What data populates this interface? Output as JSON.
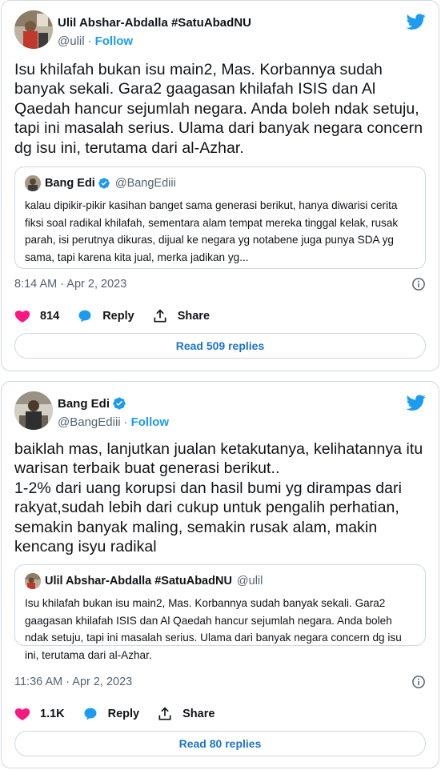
{
  "colors": {
    "accent": "#1d9bf0",
    "like": "#f91880",
    "text": "#0f1419",
    "muted": "#536471",
    "border": "#cfd9de"
  },
  "tweets": [
    {
      "author": {
        "name": "Ulil Abshar-Abdalla #SatuAbadNU",
        "handle": "@ulil",
        "verified": false
      },
      "follow_label": "Follow",
      "separator": "·",
      "text": "Isu khilafah bukan isu main2, Mas. Korbannya sudah banyak sekali. Gara2 gaagasan khilafah ISIS dan Al Qaedah hancur sejumlah negara. Anda boleh ndak setuju, tapi ini masalah serius. Ulama dari banyak negara concern dg isu ini, terutama dari al-Azhar.",
      "quote": {
        "name": "Bang Edi",
        "handle": "@BangEdiii",
        "verified": true,
        "text": "kalau dipikir-pikir kasihan banget sama generasi berikut, hanya diwarisi cerita fiksi soal radikal khilafah, sementara alam tempat mereka tinggal kelak, rusak parah, isi perutnya dikuras, dijual ke negara yg notabene juga punya SDA yg sama, tapi karena kita jual, merka jadikan yg..."
      },
      "timestamp": "8:14 AM · Apr 2, 2023",
      "likes": "814",
      "reply_label": "Reply",
      "share_label": "Share",
      "read_replies_label": "Read 509 replies"
    },
    {
      "author": {
        "name": "Bang Edi",
        "handle": "@BangEdiii",
        "verified": true
      },
      "follow_label": "Follow",
      "separator": "·",
      "text": "baiklah mas, lanjutkan jualan ketakutanya, kelihatannya itu warisan terbaik buat generasi berikut..\n1-2% dari uang korupsi dan hasil bumi yg dirampas dari rakyat,sudah lebih dari cukup untuk pengalih perhatian, semakin banyak maling, semakin rusak alam, makin kencang isyu radikal",
      "quote": {
        "name": "Ulil Abshar-Abdalla #SatuAbadNU",
        "handle": "@ulil",
        "verified": false,
        "text": "Isu khilafah bukan isu main2, Mas. Korbannya sudah banyak sekali. Gara2 gaagasan khilafah ISIS dan Al Qaedah hancur sejumlah negara. Anda boleh ndak setuju, tapi ini masalah serius. Ulama dari banyak negara concern dg isu ini, terutama dari al-Azhar."
      },
      "timestamp": "11:36 AM · Apr 2, 2023",
      "likes": "1.1K",
      "reply_label": "Reply",
      "share_label": "Share",
      "read_replies_label": "Read 80 replies"
    }
  ]
}
